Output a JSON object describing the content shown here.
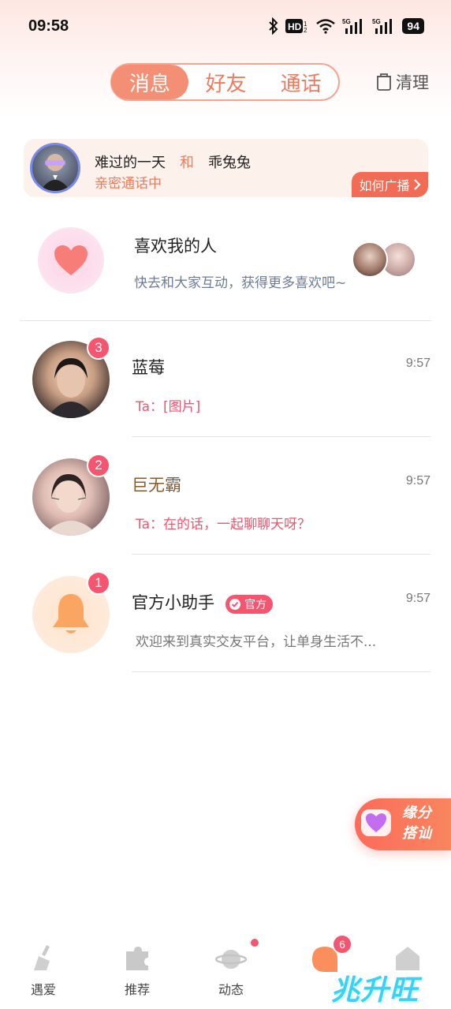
{
  "status_bar": {
    "time": "09:58",
    "battery": "94"
  },
  "header": {
    "tabs": [
      {
        "label": "消息",
        "active": true
      },
      {
        "label": "好友",
        "active": false
      },
      {
        "label": "通话",
        "active": false
      }
    ],
    "clean_label": "清理"
  },
  "banner": {
    "user_a": "难过的一天",
    "and_word": "和",
    "user_b": "乖兔兔",
    "status": "亲密通话中",
    "broadcast_label": "如何广播"
  },
  "likes": {
    "title": "喜欢我的人",
    "subtitle": "快去和大家互动，获得更多喜欢吧~"
  },
  "chats": [
    {
      "name": "蓝莓",
      "time": "9:57",
      "message": "Ta：[图片]",
      "unread": "3"
    },
    {
      "name": "巨无霸",
      "time": "9:57",
      "message": "Ta：在的话，一起聊聊天呀？",
      "unread": "2"
    },
    {
      "name": "官方小助手",
      "official_label": "官方",
      "time": "9:57",
      "message": "欢迎来到真实交友平台，让单身生活不...",
      "unread": "1"
    }
  ],
  "fate_widget": {
    "line1": "缘分",
    "line2": "搭讪"
  },
  "bottom_nav": [
    {
      "label": "遇爱",
      "icon": "broom-icon"
    },
    {
      "label": "推荐",
      "icon": "puzzle-icon"
    },
    {
      "label": "动态",
      "icon": "planet-icon"
    },
    {
      "label": "",
      "icon": "message-bubble-icon",
      "badge": "6"
    },
    {
      "label": "",
      "icon": "home-icon"
    }
  ],
  "watermark": "兆升旺",
  "colors": {
    "accent": "#f07a5e",
    "badge": "#f5556f",
    "muted_blue": "#6b7c9a"
  }
}
